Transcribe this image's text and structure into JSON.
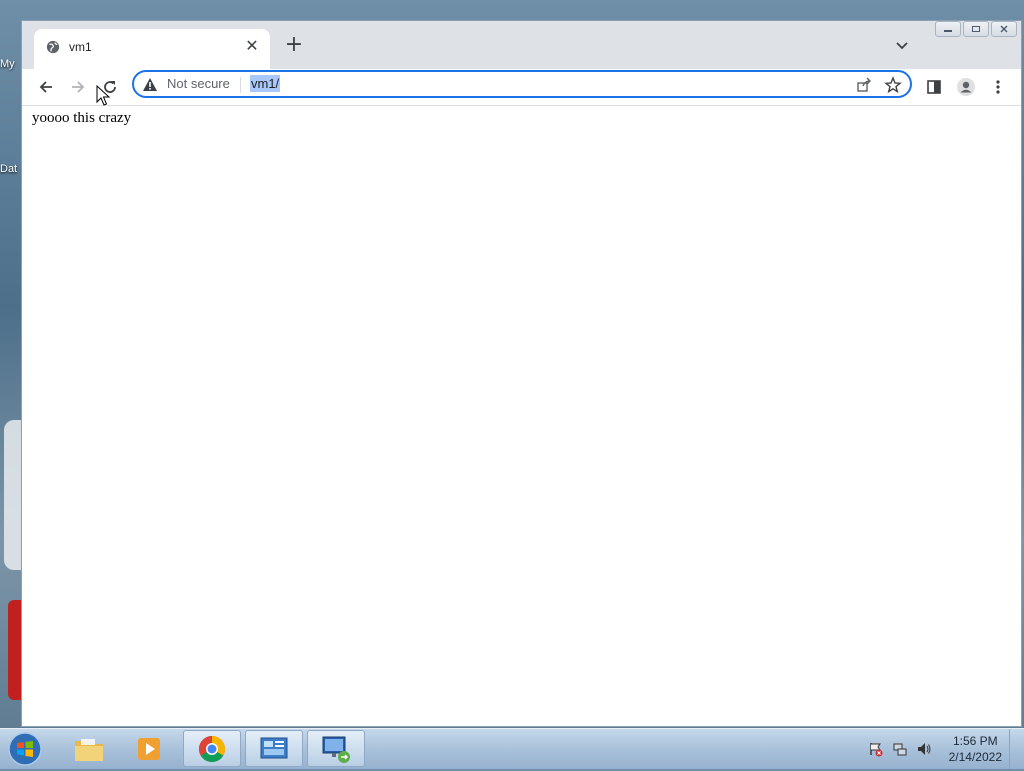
{
  "desktop": {
    "fragments": [
      "My",
      "Dat"
    ]
  },
  "browser": {
    "tab": {
      "title": "vm1",
      "favicon": "globe-icon",
      "close": "close-icon"
    },
    "new_tab": "plus-icon",
    "tab_search": "chevron-down-icon",
    "window_controls": [
      "minimize-icon",
      "maximize-icon",
      "close-icon"
    ],
    "toolbar": {
      "back": "arrow-left-icon",
      "forward": "arrow-right-icon",
      "reload": "reload-icon",
      "security_label": "Not secure",
      "url": "vm1/",
      "share": "share-icon",
      "bookmark": "star-icon",
      "side_panel": "side-panel-icon",
      "profile": "profile-icon",
      "menu": "kebab-menu-icon"
    },
    "page": {
      "text": "yoooo this crazy"
    }
  },
  "taskbar": {
    "start": "windows-start-icon",
    "apps": [
      "file-explorer-icon",
      "media-player-icon",
      "chrome-icon",
      "server-manager-icon",
      "remote-desktop-icon"
    ],
    "tray_icons": [
      "action-center-icon",
      "network-icon",
      "volume-icon"
    ],
    "clock": {
      "time": "1:56 PM",
      "date": "2/14/2022"
    }
  },
  "colors": {
    "accent": "#1a73e8",
    "selection": "#a8c7fa",
    "tabbar": "#dee1e6"
  }
}
